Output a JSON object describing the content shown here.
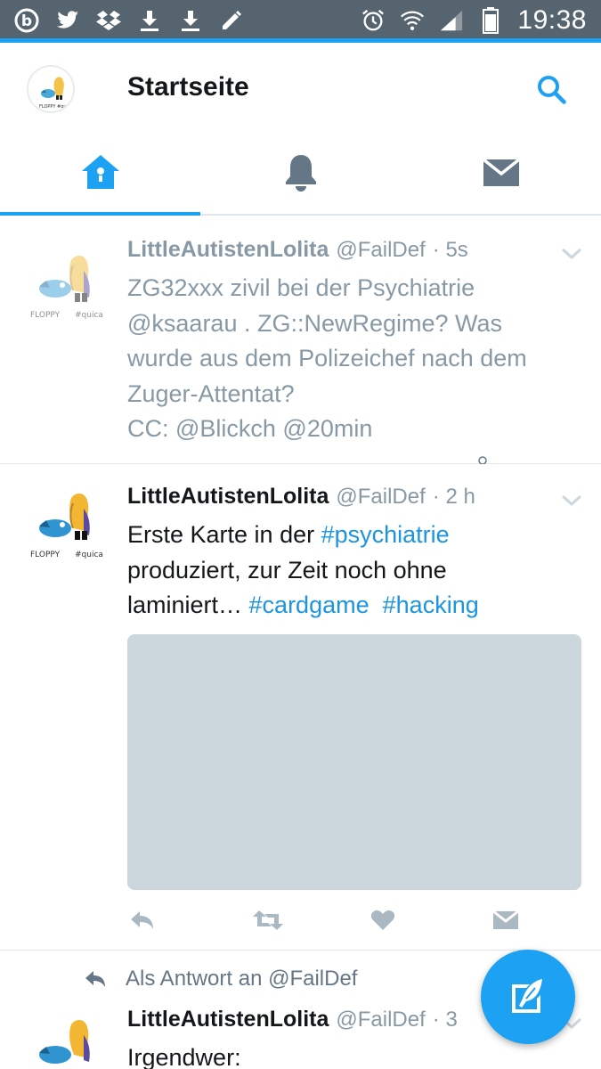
{
  "status_bar": {
    "time": "19:38",
    "left_icons": [
      "beats-icon",
      "twitter-icon",
      "dropbox-icon",
      "download-icon",
      "download-icon",
      "pencil-icon"
    ],
    "right_icons": [
      "alarm-icon",
      "wifi-icon",
      "signal-icon",
      "battery-icon"
    ]
  },
  "header": {
    "title": "Startseite"
  },
  "tabs": [
    {
      "name": "home",
      "icon": "home-icon",
      "active": true
    },
    {
      "name": "notifications",
      "icon": "bell-icon",
      "active": false
    },
    {
      "name": "messages",
      "icon": "envelope-icon",
      "active": false
    }
  ],
  "tweets": [
    {
      "name": "LittleAutistenLolita",
      "handle": "@FailDef",
      "time": "· 5s",
      "lines": [
        "ZG32xxx zivil bei der Psychiatrie",
        "@ksaarau . ZG::NewRegime? Was",
        "wurde aus dem Polizeichef nach dem",
        "Zuger-Attentat?",
        "CC: @Blickch @20min"
      ]
    },
    {
      "name": "LittleAutistenLolita",
      "handle": "@FailDef",
      "time": "· 2 h",
      "line1_text": "Erste Karte in der ",
      "line1_tag": "#psychiatrie",
      "line2": "produziert, zur Zeit noch ohne",
      "line3_text": "laminiert… ",
      "line3_tag1": "#cardgame",
      "line3_tag2": "#hacking"
    },
    {
      "reply_context": "Als Antwort an @FailDef",
      "name": "LittleAutistenLolita",
      "handle": "@FailDef",
      "time": "· 3",
      "text": "Irgendwer:"
    }
  ],
  "avatar_caption": {
    "left": "FLOPPY",
    "right": "#quica"
  },
  "colors": {
    "accent": "#1da1f2",
    "status_bar": "#56646f",
    "hashtag": "#1b95e0",
    "muted": "#8899a6",
    "media_placeholder": "#ccd6dd"
  }
}
